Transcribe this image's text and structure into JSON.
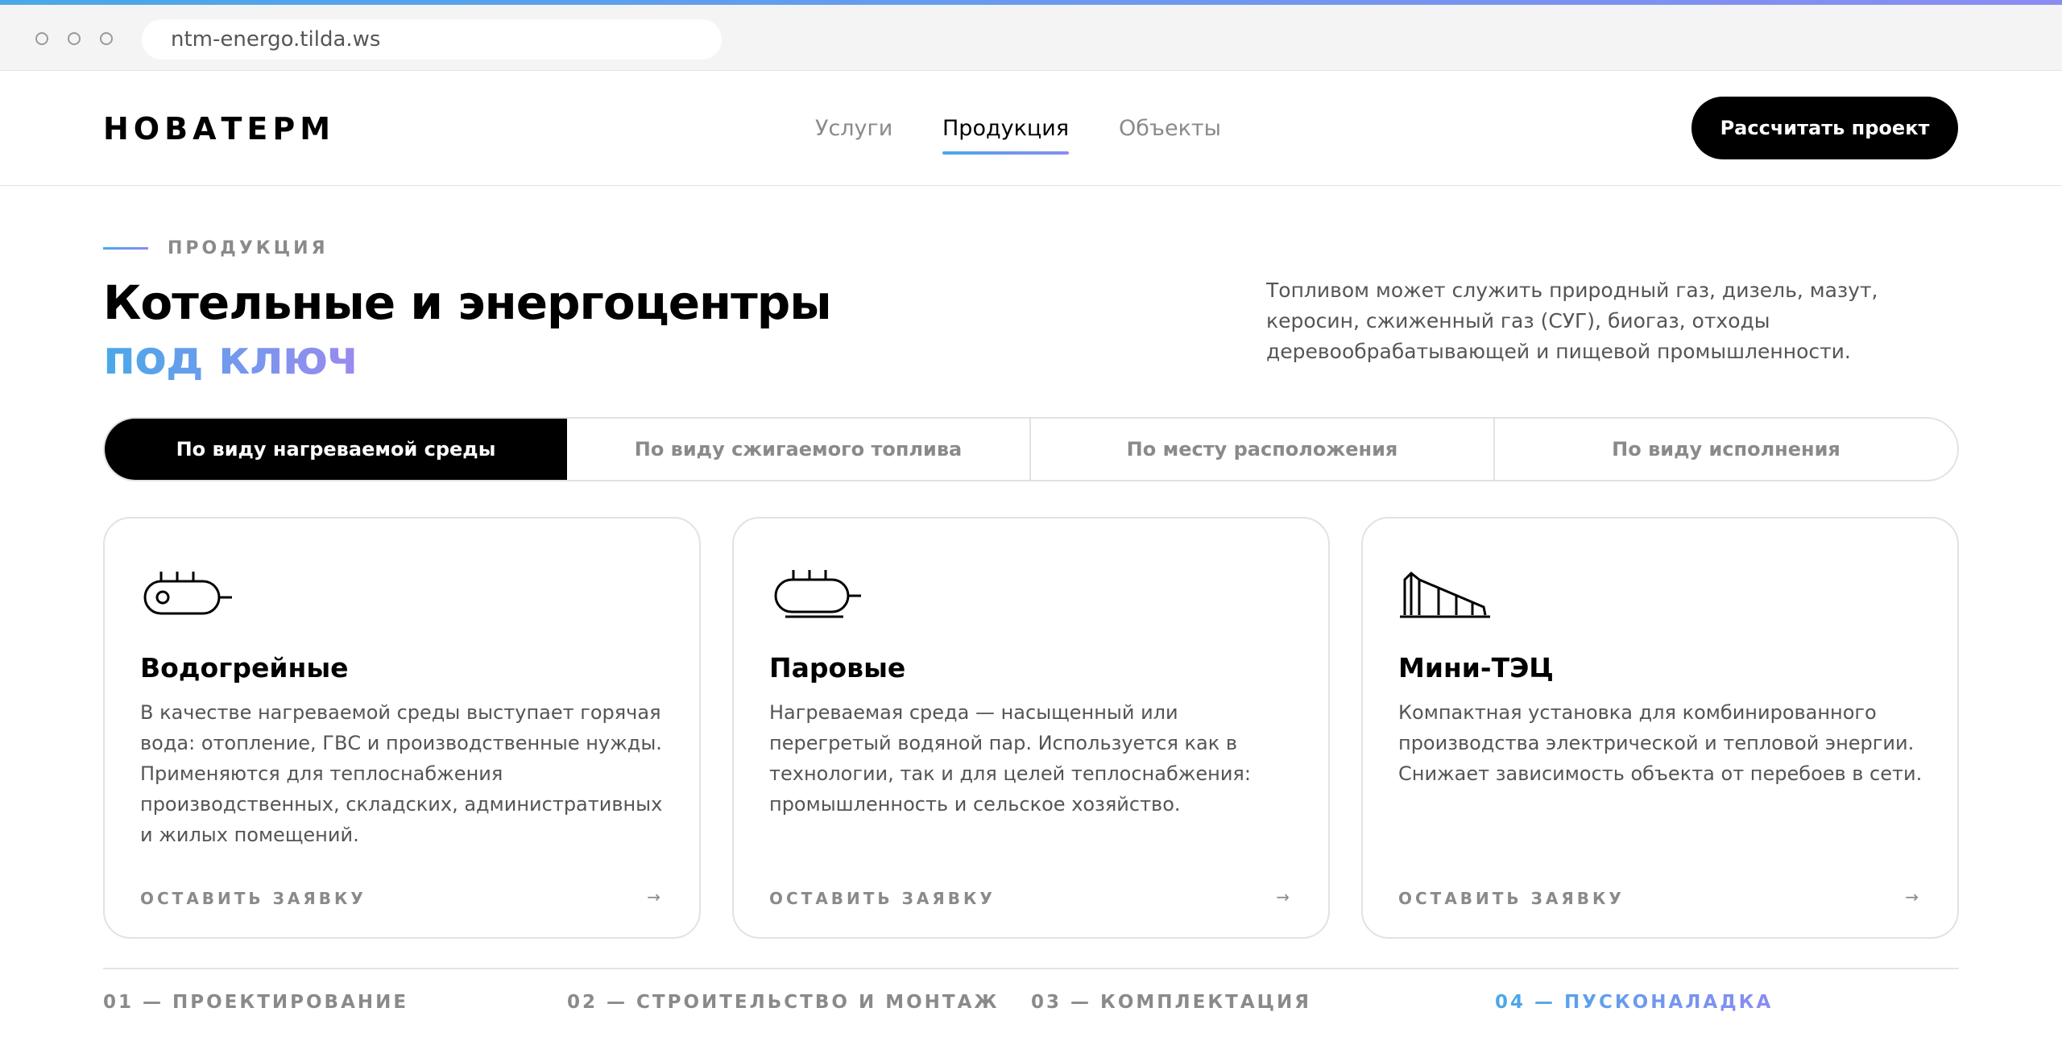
{
  "browser": {
    "url": "ntm-energo.tilda.ws"
  },
  "header": {
    "logo": "НОВАТЕРМ",
    "nav": [
      {
        "label": "Услуги",
        "active": false
      },
      {
        "label": "Продукция",
        "active": true
      },
      {
        "label": "Объекты",
        "active": false
      }
    ],
    "cta_label": "Рассчитать проект"
  },
  "intro": {
    "eyebrow": "ПРОДУКЦИЯ",
    "title": "Котельные и энергоцентры",
    "title_accent": "под ключ",
    "description": "Топливом может служить природный газ, дизель, мазут, керосин, сжиженный газ (СУГ), биогаз, отходы деревообрабатывающей и пищевой промышленности."
  },
  "tabs": [
    {
      "label": "По виду нагреваемой среды",
      "active": true
    },
    {
      "label": "По виду сжигаемого топлива",
      "active": false
    },
    {
      "label": "По месту расположения",
      "active": false
    },
    {
      "label": "По виду исполнения",
      "active": false
    }
  ],
  "cards": [
    {
      "icon": "water-boiler-icon",
      "title": "Водогрейные",
      "text": "В качестве нагреваемой среды выступает горячая вода: отопление, ГВС и производственные нужды. Применяются для теплоснабжения производственных, складских, административных и жилых помещений.",
      "link": "ОСТАВИТЬ ЗАЯВКУ",
      "arrow": "→"
    },
    {
      "icon": "steam-boiler-icon",
      "title": "Паровые",
      "text": "Нагреваемая среда — насыщенный или перегретый водяной пар. Используется как в технологии, так и для целей теплоснабжения: промышленность и сельское хозяйство.",
      "link": "ОСТАВИТЬ ЗАЯВКУ",
      "arrow": "→"
    },
    {
      "icon": "power-plant-icon",
      "title": "Мини-ТЭЦ",
      "text": "Компактная установка для комбинированного производства электрической и тепловой энергии. Снижает зависимость объекта от перебоев в сети.",
      "link": "ОСТАВИТЬ ЗАЯВКУ",
      "arrow": "→"
    }
  ],
  "steps": [
    {
      "label": "01 — ПРОЕКТИРОВАНИЕ",
      "active": false
    },
    {
      "label": "02 — СТРОИТЕЛЬСТВО И МОНТАЖ",
      "active": false
    },
    {
      "label": "03 — КОМПЛЕКТАЦИЯ",
      "active": false
    },
    {
      "label": "04 — ПУСКОНАЛАДКА",
      "active": true
    }
  ],
  "colors": {
    "accent_start": "#4aa8e8",
    "accent_end": "#8a8cf2",
    "primary": "#000000",
    "muted": "#8a8a8a"
  }
}
